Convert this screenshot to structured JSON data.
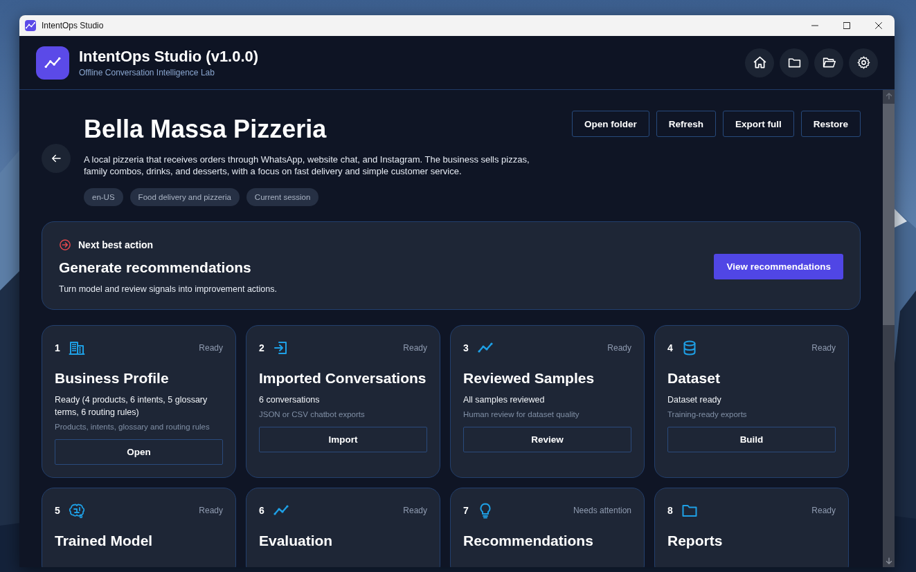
{
  "window": {
    "title": "IntentOps Studio"
  },
  "app_header": {
    "title": "IntentOps Studio (v1.0.0)",
    "subtitle": "Offline Conversation Intelligence Lab"
  },
  "project": {
    "name": "Bella Massa Pizzeria",
    "description": "A local pizzeria that receives orders through WhatsApp, website chat, and Instagram. The business sells pizzas, family combos, drinks, and desserts, with a focus on fast delivery and simple customer service.",
    "tags": [
      "en-US",
      "Food delivery and pizzeria",
      "Current session"
    ]
  },
  "actions": [
    "Open folder",
    "Refresh",
    "Export full",
    "Restore"
  ],
  "next_action": {
    "label": "Next best action",
    "title": "Generate recommendations",
    "description": "Turn model and review signals into improvement actions.",
    "button": "View recommendations"
  },
  "steps": [
    {
      "number": "1",
      "status": "Ready",
      "title": "Business Profile",
      "summary": "Ready (4 products, 6 intents, 5 glossary terms, 6 routing rules)",
      "hint": "Products, intents, glossary and routing rules",
      "button": "Open"
    },
    {
      "number": "2",
      "status": "Ready",
      "title": "Imported Conversations",
      "summary": "6 conversations",
      "hint": "JSON or CSV chatbot exports",
      "button": "Import"
    },
    {
      "number": "3",
      "status": "Ready",
      "title": "Reviewed Samples",
      "summary": "All samples reviewed",
      "hint": "Human review for dataset quality",
      "button": "Review"
    },
    {
      "number": "4",
      "status": "Ready",
      "title": "Dataset",
      "summary": "Dataset ready",
      "hint": "Training-ready exports",
      "button": "Build"
    },
    {
      "number": "5",
      "status": "Ready",
      "title": "Trained Model"
    },
    {
      "number": "6",
      "status": "Ready",
      "title": "Evaluation"
    },
    {
      "number": "7",
      "status": "Needs attention",
      "title": "Recommendations"
    },
    {
      "number": "8",
      "status": "Ready",
      "title": "Reports"
    }
  ]
}
